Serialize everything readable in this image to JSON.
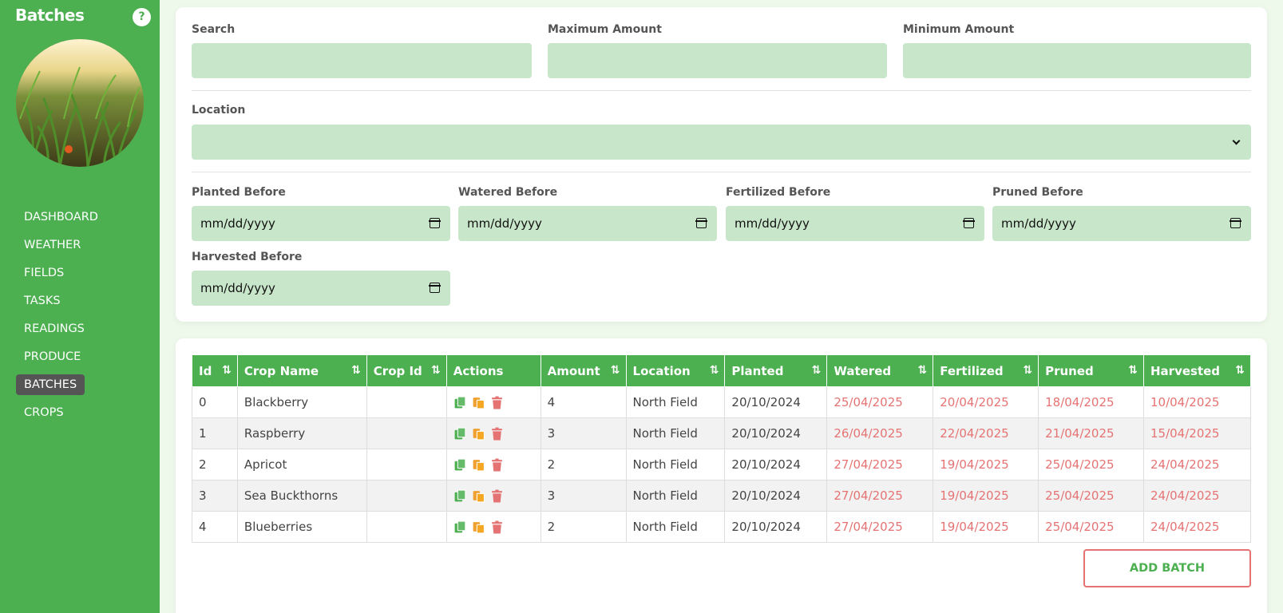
{
  "sidebar": {
    "title": "Batches",
    "help_label": "?",
    "nav": [
      {
        "label": "DASHBOARD"
      },
      {
        "label": "WEATHER"
      },
      {
        "label": "FIELDS"
      },
      {
        "label": "TASKS"
      },
      {
        "label": "READINGS"
      },
      {
        "label": "PRODUCE"
      },
      {
        "label": "BATCHES",
        "active": true
      },
      {
        "label": "CROPS"
      }
    ]
  },
  "filters": {
    "search_label": "Search",
    "max_amount_label": "Maximum Amount",
    "min_amount_label": "Minimum Amount",
    "location_label": "Location",
    "planted_before_label": "Planted Before",
    "watered_before_label": "Watered Before",
    "fertilized_before_label": "Fertilized Before",
    "pruned_before_label": "Pruned Before",
    "harvested_before_label": "Harvested Before",
    "date_placeholder": "mm/dd/yyyy"
  },
  "table": {
    "columns": [
      "Id",
      "Crop Name",
      "Crop Id",
      "Actions",
      "Amount",
      "Location",
      "Planted",
      "Watered",
      "Fertilized",
      "Pruned",
      "Harvested"
    ],
    "sort_icon": "⇅",
    "rows": [
      {
        "id": "0",
        "crop_name": "Blackberry",
        "crop_id": "",
        "amount": "4",
        "location": "North Field",
        "planted": "20/10/2024",
        "watered": "25/04/2025",
        "fertilized": "20/04/2025",
        "pruned": "18/04/2025",
        "harvested": "10/04/2025"
      },
      {
        "id": "1",
        "crop_name": "Raspberry",
        "crop_id": "",
        "amount": "3",
        "location": "North Field",
        "planted": "20/10/2024",
        "watered": "26/04/2025",
        "fertilized": "22/04/2025",
        "pruned": "21/04/2025",
        "harvested": "15/04/2025"
      },
      {
        "id": "2",
        "crop_name": "Apricot",
        "crop_id": "",
        "amount": "2",
        "location": "North Field",
        "planted": "20/10/2024",
        "watered": "27/04/2025",
        "fertilized": "19/04/2025",
        "pruned": "25/04/2025",
        "harvested": "24/04/2025"
      },
      {
        "id": "3",
        "crop_name": "Sea Buckthorns",
        "crop_id": "",
        "amount": "3",
        "location": "North Field",
        "planted": "20/10/2024",
        "watered": "27/04/2025",
        "fertilized": "19/04/2025",
        "pruned": "25/04/2025",
        "harvested": "24/04/2025"
      },
      {
        "id": "4",
        "crop_name": "Blueberries",
        "crop_id": "",
        "amount": "2",
        "location": "North Field",
        "planted": "20/10/2024",
        "watered": "27/04/2025",
        "fertilized": "19/04/2025",
        "pruned": "25/04/2025",
        "harvested": "24/04/2025"
      }
    ]
  },
  "add_button_label": "ADD BATCH",
  "colors": {
    "primary": "#4caf50",
    "input_bg": "#c8e6c9",
    "overdue_text": "#e57373",
    "copy_icon": "#4caf50",
    "duplicate_icon": "#f0a030",
    "delete_icon": "#e57373"
  },
  "action_icons": [
    "copy-icon",
    "duplicate-icon",
    "trash-icon"
  ]
}
